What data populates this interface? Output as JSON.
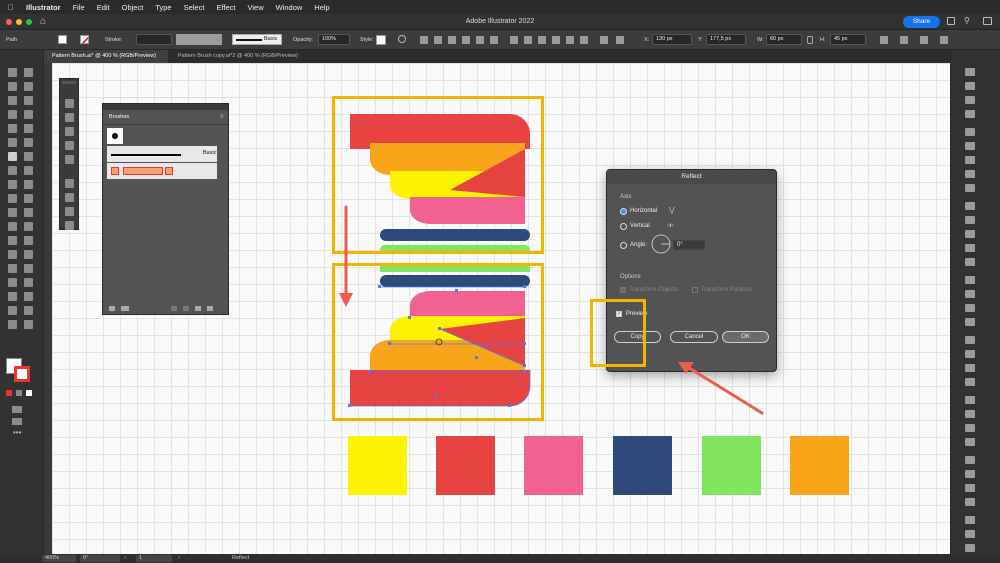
{
  "menubar": {
    "app_name": "Illustrator",
    "items": [
      "File",
      "Edit",
      "Object",
      "Type",
      "Select",
      "Effect",
      "View",
      "Window",
      "Help"
    ]
  },
  "appbar": {
    "title": "Adobe Illustrator 2022",
    "share_label": "Share"
  },
  "controlbar": {
    "selection_label": "Path",
    "stroke_label": "Stroke:",
    "brush_label": "Basic",
    "opacity_label": "Opacity:",
    "opacity_value": "100%",
    "style_label": "Style:",
    "x_label": "X:",
    "x_value": "130 px",
    "y_label": "Y:",
    "y_value": "177,5 px",
    "w_label": "W:",
    "w_value": "60 px",
    "h_label": "H:",
    "h_value": "45 px"
  },
  "tabs": [
    {
      "label": "Pattern Brush.ai* @ 400 % (RGB/Preview)"
    },
    {
      "label": "Pattern Brush copy.ai*2 @ 400 % (RGB/Preview)"
    }
  ],
  "brushes_panel": {
    "title": "Brushes",
    "basic_label": "Basic"
  },
  "reflect_dialog": {
    "title": "Reflect",
    "axis_label": "Axis",
    "horizontal_label": "Horizontal",
    "vertical_label": "Vertical",
    "angle_label": "Angle:",
    "angle_value": "0°",
    "options_label": "Options",
    "transform_objects_label": "Transform Objects",
    "transform_patterns_label": "Transform Patterns",
    "preview_label": "Preview",
    "copy_label": "Copy",
    "cancel_label": "Cancel",
    "ok_label": "OK",
    "selected_axis": "Horizontal",
    "preview_checked": true
  },
  "statusbar": {
    "zoom": "400%",
    "rotation": "0°",
    "artboard": "1",
    "tool_name": "Reflect"
  },
  "colors": {
    "red": "#e84343",
    "orange": "#f8a51b",
    "yellow": "#fff200",
    "pink": "#f06292",
    "navy": "#2e4a7a",
    "green": "#82e35e",
    "highlight": "#f4b400",
    "arrow": "#ee5c4f",
    "selection": "#4a7cf5"
  },
  "swatches": [
    "#fff200",
    "#e84343",
    "#f06292",
    "#2e4a7a",
    "#82e35e",
    "#f8a51b"
  ]
}
